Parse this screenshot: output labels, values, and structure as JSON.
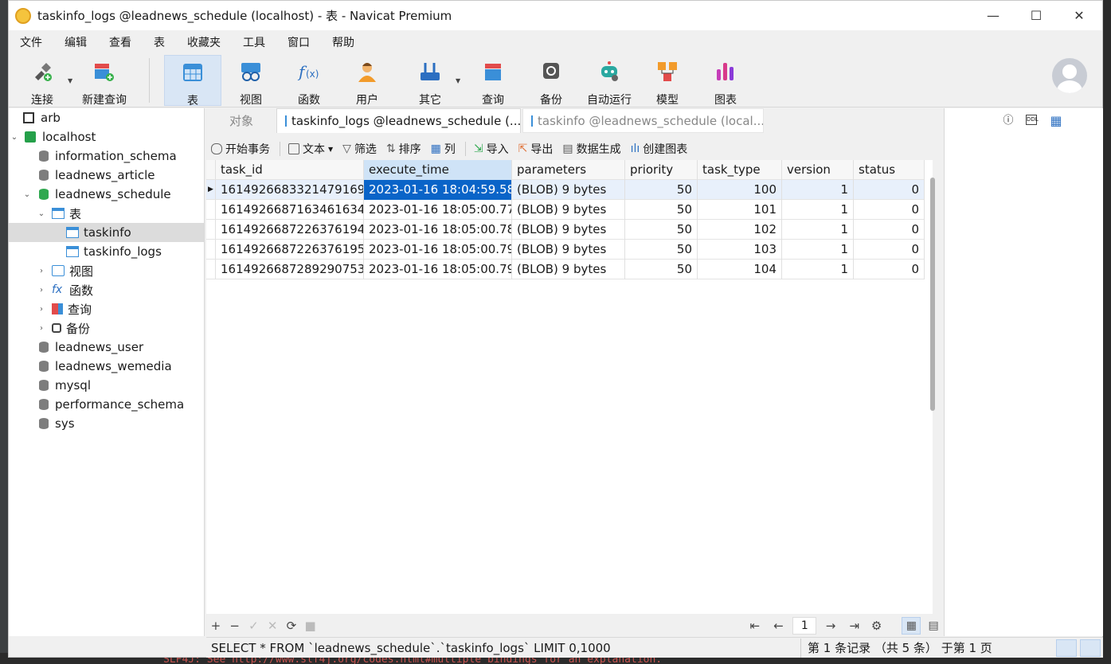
{
  "window": {
    "title": "taskinfo_logs @leadnews_schedule (localhost) - 表 - Navicat Premium",
    "minimize": "—",
    "maximize": "☐",
    "close": "✕"
  },
  "background": {
    "console_text": "SLF4J: See http://www.slf4j.org/codes.html#multiple_bindings for an explanation."
  },
  "menu": [
    "文件",
    "编辑",
    "查看",
    "表",
    "收藏夹",
    "工具",
    "窗口",
    "帮助"
  ],
  "toolbar": {
    "items": [
      {
        "label": "连接",
        "icon": "connection-icon"
      },
      {
        "label": "新建查询",
        "icon": "new-query-icon"
      },
      {
        "label": "表",
        "icon": "table-icon",
        "active": true
      },
      {
        "label": "视图",
        "icon": "view-icon"
      },
      {
        "label": "函数",
        "icon": "function-icon"
      },
      {
        "label": "用户",
        "icon": "user-icon"
      },
      {
        "label": "其它",
        "icon": "tools-icon"
      },
      {
        "label": "查询",
        "icon": "query-icon"
      },
      {
        "label": "备份",
        "icon": "backup-icon"
      },
      {
        "label": "自动运行",
        "icon": "robot-icon"
      },
      {
        "label": "模型",
        "icon": "model-icon"
      },
      {
        "label": "图表",
        "icon": "chart-icon"
      }
    ]
  },
  "tree": {
    "items": [
      {
        "label": "arb"
      },
      {
        "label": "localhost"
      },
      {
        "label": "information_schema"
      },
      {
        "label": "leadnews_article"
      },
      {
        "label": "leadnews_schedule"
      },
      {
        "label": "表"
      },
      {
        "label": "taskinfo"
      },
      {
        "label": "taskinfo_logs"
      },
      {
        "label": "视图"
      },
      {
        "label": "函数"
      },
      {
        "label": "查询"
      },
      {
        "label": "备份"
      },
      {
        "label": "leadnews_user"
      },
      {
        "label": "leadnews_wemedia"
      },
      {
        "label": "mysql"
      },
      {
        "label": "performance_schema"
      },
      {
        "label": "sys"
      }
    ]
  },
  "tabs": {
    "objects": "对象",
    "active": "taskinfo_logs @leadnews_schedule (...",
    "other": "taskinfo @leadnews_schedule (local..."
  },
  "table_toolbar": {
    "begin_txn": "开始事务",
    "text": "文本",
    "filter": "筛选",
    "sort": "排序",
    "columns": "列",
    "import": "导入",
    "export": "导出",
    "generate": "数据生成",
    "create_chart": "创建图表"
  },
  "grid": {
    "columns": [
      "task_id",
      "execute_time",
      "parameters",
      "priority",
      "task_type",
      "version",
      "status"
    ],
    "rows": [
      [
        "1614926683321479169",
        "2023-01-16 18:04:59.58",
        "(BLOB) 9 bytes",
        "50",
        "100",
        "1",
        "0"
      ],
      [
        "1614926687163461634",
        "2023-01-16 18:05:00.77",
        "(BLOB) 9 bytes",
        "50",
        "101",
        "1",
        "0"
      ],
      [
        "1614926687226376194",
        "2023-01-16 18:05:00.78",
        "(BLOB) 9 bytes",
        "50",
        "102",
        "1",
        "0"
      ],
      [
        "1614926687226376195",
        "2023-01-16 18:05:00.79",
        "(BLOB) 9 bytes",
        "50",
        "103",
        "1",
        "0"
      ],
      [
        "1614926687289290753",
        "2023-01-16 18:05:00.79",
        "(BLOB) 9 bytes",
        "50",
        "104",
        "1",
        "0"
      ]
    ],
    "selected_row": 0,
    "selected_column": "execute_time"
  },
  "grid_nav": {
    "add": "+",
    "remove": "−",
    "apply": "✓",
    "discard": "✕",
    "refresh": "⟳",
    "stop": "■",
    "first": "⇤",
    "prev": "←",
    "page": "1",
    "next": "→",
    "last": "⇥",
    "settings": "⚙",
    "grid_view": "▦",
    "form_view": "▤"
  },
  "status": {
    "sql": "SELECT * FROM `leadnews_schedule`.`taskinfo_logs` LIMIT 0,1000",
    "records": "第 1 条记录 （共 5 条） 于第 1 页"
  },
  "right_pane": {
    "info": "ⓘ",
    "ddl": "DDL",
    "grid": "▦"
  }
}
